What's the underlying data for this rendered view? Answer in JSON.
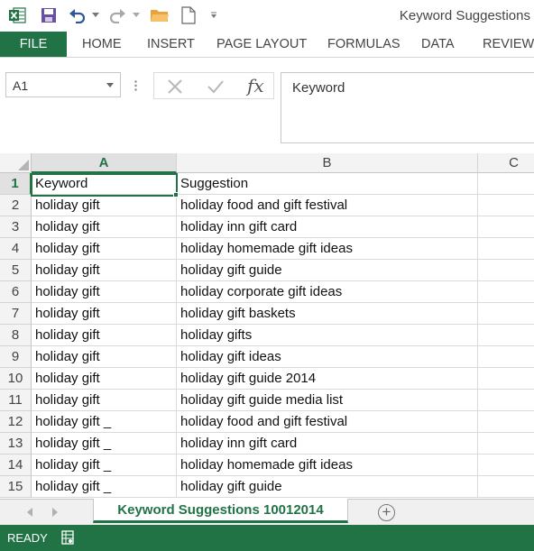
{
  "window": {
    "title": "Keyword Suggestions"
  },
  "ribbon": {
    "tabs": [
      {
        "label": "FILE",
        "active": true
      },
      {
        "label": "HOME"
      },
      {
        "label": "INSERT"
      },
      {
        "label": "PAGE LAYOUT"
      },
      {
        "label": "FORMULAS"
      },
      {
        "label": "DATA"
      },
      {
        "label": "REVIEW"
      }
    ]
  },
  "formula_bar": {
    "name_box": "A1",
    "fx_label": "fx",
    "content": "Keyword"
  },
  "grid": {
    "columns": [
      "A",
      "B",
      "C"
    ],
    "selected_cell": "A1",
    "rows": [
      {
        "num": "1",
        "a": "Keyword",
        "b": "Suggestion"
      },
      {
        "num": "2",
        "a": "holiday gift",
        "b": "holiday food and gift festival"
      },
      {
        "num": "3",
        "a": "holiday gift",
        "b": "holiday inn gift card"
      },
      {
        "num": "4",
        "a": "holiday gift",
        "b": "holiday homemade gift ideas"
      },
      {
        "num": "5",
        "a": "holiday gift",
        "b": "holiday gift guide"
      },
      {
        "num": "6",
        "a": "holiday gift",
        "b": "holiday corporate gift ideas"
      },
      {
        "num": "7",
        "a": "holiday gift",
        "b": "holiday gift baskets"
      },
      {
        "num": "8",
        "a": "holiday gift",
        "b": "holiday gifts"
      },
      {
        "num": "9",
        "a": "holiday gift",
        "b": "holiday gift ideas"
      },
      {
        "num": "10",
        "a": "holiday gift",
        "b": "holiday gift guide 2014"
      },
      {
        "num": "11",
        "a": "holiday gift",
        "b": "holiday gift guide media list"
      },
      {
        "num": "12",
        "a": "holiday gift _",
        "b": "holiday food and gift festival"
      },
      {
        "num": "13",
        "a": "holiday gift _",
        "b": "holiday inn gift card"
      },
      {
        "num": "14",
        "a": "holiday gift _",
        "b": "holiday homemade gift ideas"
      },
      {
        "num": "15",
        "a": "holiday gift _",
        "b": "holiday gift guide"
      }
    ]
  },
  "sheets": {
    "active_tab": "Keyword Suggestions 10012014",
    "add_label": "+"
  },
  "status_bar": {
    "status": "READY"
  },
  "colors": {
    "accent": "#217346",
    "header_bg": "#f3f3f3",
    "grid_line": "#dadada"
  }
}
